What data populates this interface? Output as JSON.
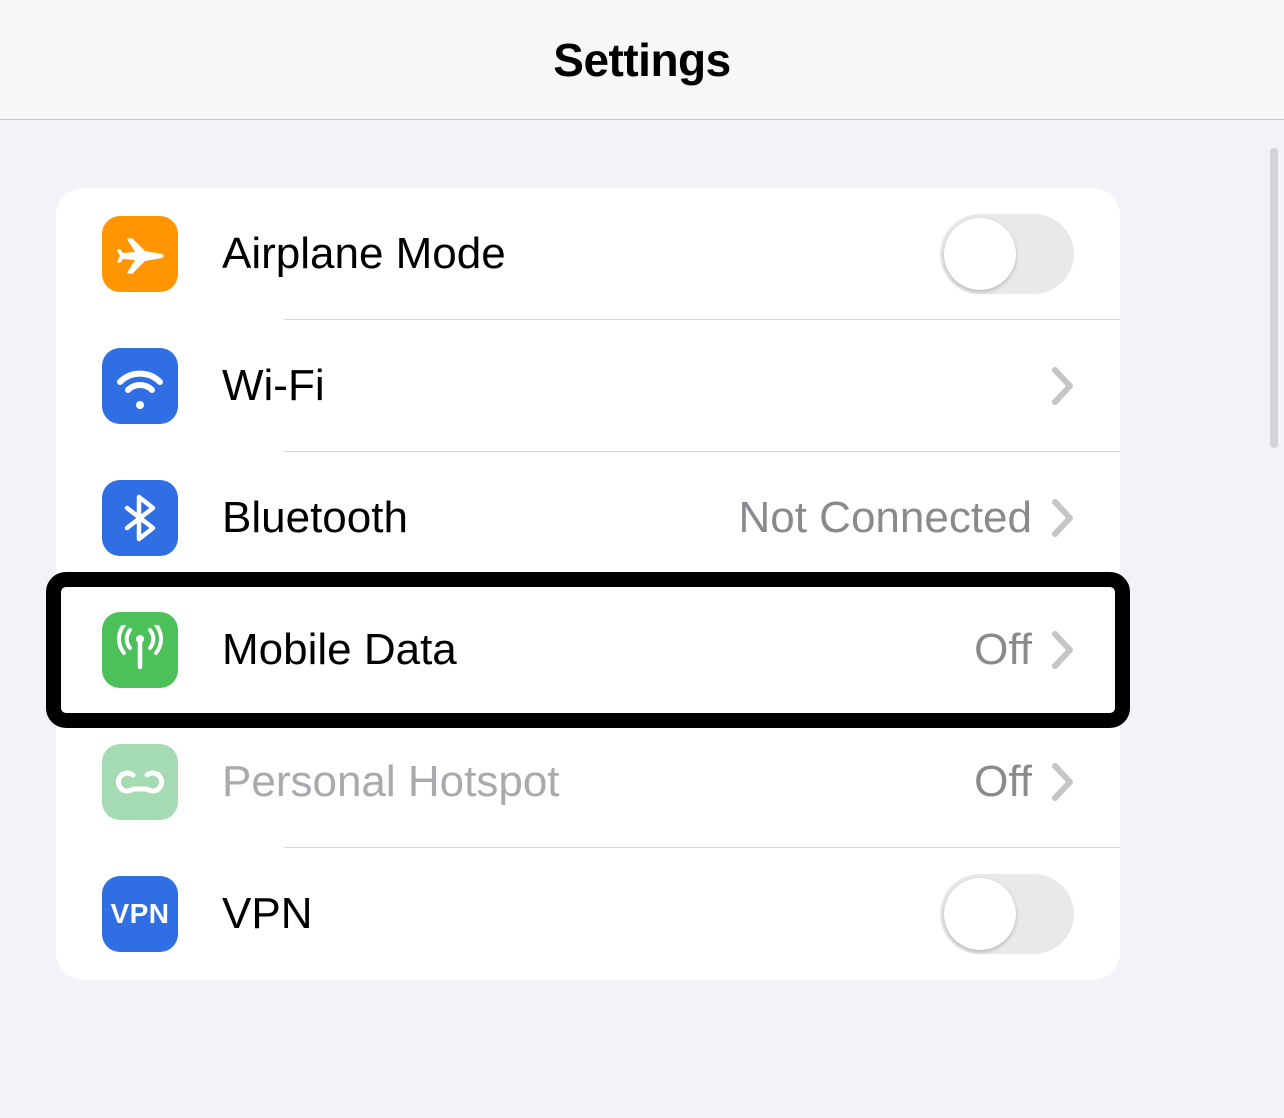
{
  "header": {
    "title": "Settings"
  },
  "rows": {
    "airplane": {
      "label": "Airplane Mode",
      "icon_bg": "#ff9500",
      "toggle": false
    },
    "wifi": {
      "label": "Wi-Fi",
      "icon_bg": "#2f6ee3"
    },
    "bluetooth": {
      "label": "Bluetooth",
      "icon_bg": "#2f6ee3",
      "detail": "Not Connected"
    },
    "mobile": {
      "label": "Mobile Data",
      "icon_bg": "#4cc15a",
      "detail": "Off"
    },
    "hotspot": {
      "label": "Personal Hotspot",
      "icon_bg": "#a4dbb3",
      "detail": "Off",
      "dim": true
    },
    "vpn": {
      "label": "VPN",
      "icon_bg": "#2f6ee3",
      "badge": "VPN",
      "toggle": false
    }
  }
}
